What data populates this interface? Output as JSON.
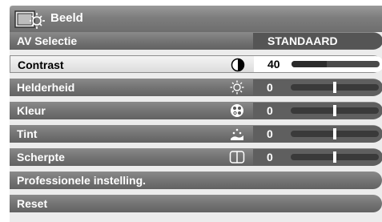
{
  "header": {
    "title": "Beeld"
  },
  "menu": {
    "av_selectie": {
      "label": "AV Selectie",
      "value": "STANDAARD"
    },
    "contrast": {
      "label": "Contrast",
      "value": "40",
      "level": 0.4,
      "icon": "contrast-icon"
    },
    "helderheid": {
      "label": "Helderheid",
      "value": "0",
      "level": 0.5,
      "icon": "brightness-sun-icon"
    },
    "kleur": {
      "label": "Kleur",
      "value": "0",
      "level": 0.5,
      "icon": "color-palette-icon"
    },
    "tint": {
      "label": "Tint",
      "value": "0",
      "level": 0.5,
      "icon": "tint-icon"
    },
    "scherpte": {
      "label": "Scherpte",
      "value": "0",
      "level": 0.5,
      "icon": "sharpness-icon"
    },
    "professioneel": {
      "label": "Professionele instelling."
    },
    "reset": {
      "label": "Reset"
    }
  }
}
